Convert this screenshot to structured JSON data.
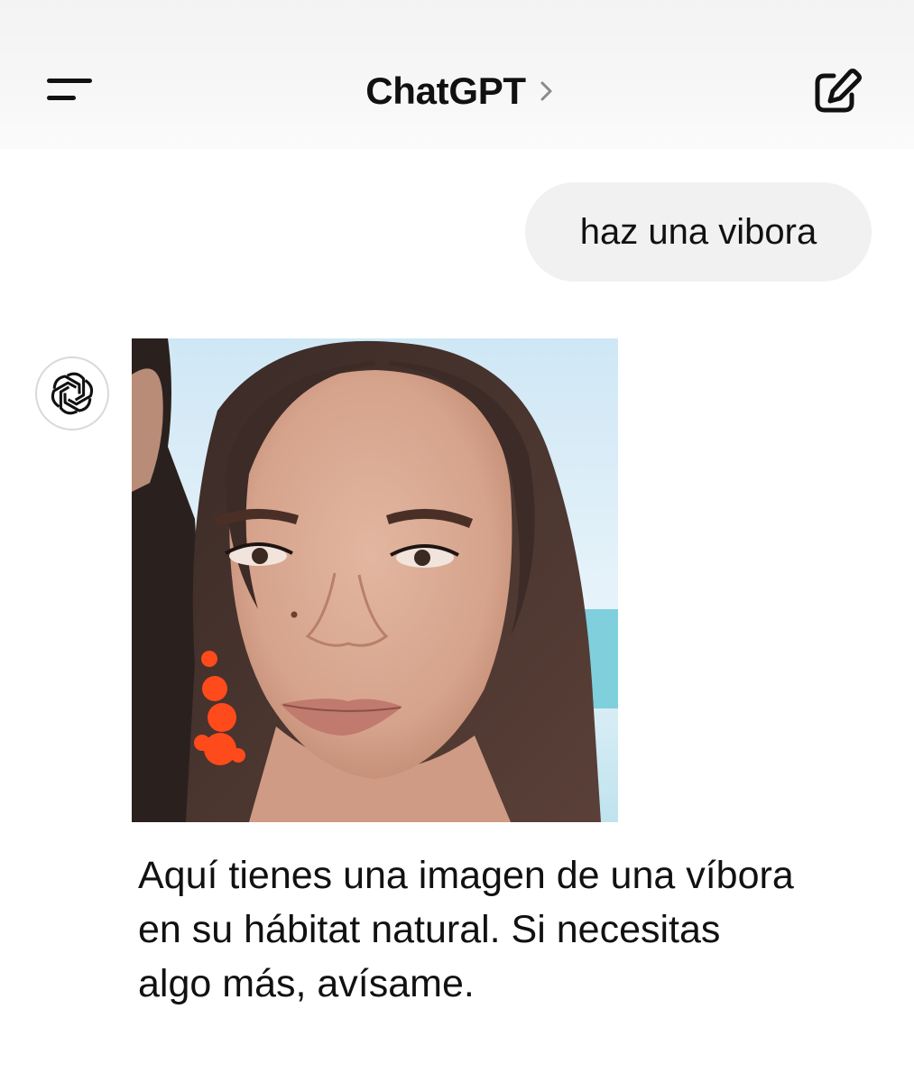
{
  "header": {
    "title": "ChatGPT",
    "menu_icon": "menu-icon",
    "chevron_icon": "chevron-right-icon",
    "compose_icon": "new-chat-icon"
  },
  "conversation": {
    "user_message": "haz una vibora",
    "assistant": {
      "avatar_icon": "openai-logo-icon",
      "image_icon": "generated-image",
      "reply_lines": [
        "Aquí tienes una imagen de una víbora",
        "en su hábitat natural. Si necesitas",
        "algo más, avísame."
      ]
    }
  },
  "colors": {
    "header_bg": "#f5f5f5",
    "bubble_bg": "#f1f1f1",
    "text": "#111111",
    "earring": "#ff4a1c"
  }
}
